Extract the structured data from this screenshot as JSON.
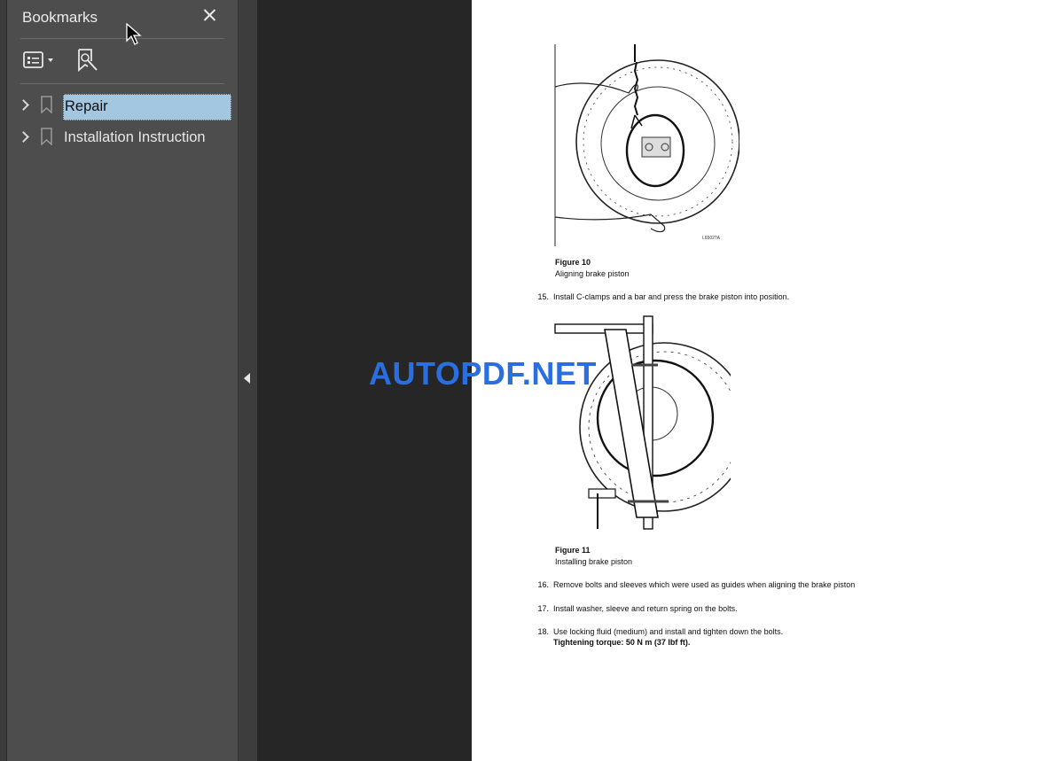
{
  "sidebar": {
    "title": "Bookmarks",
    "bookmarks": [
      {
        "label": "Repair",
        "selected": true
      },
      {
        "label": "Installation Instruction",
        "selected": false
      }
    ]
  },
  "icons": {
    "close": "close-icon",
    "options": "bookmark-options-icon",
    "find": "find-current-bookmark-icon",
    "collapse": "collapse-panel-arrow-icon"
  },
  "document": {
    "figure10": {
      "title": "Figure 10",
      "caption": "Aligning brake piston",
      "code": "L65027A"
    },
    "step15": {
      "num": "15.",
      "text": "Install C-clamps and a bar and press the brake piston into position."
    },
    "figure11": {
      "title": "Figure 11",
      "caption": "Installing brake piston"
    },
    "step16": {
      "num": "16.",
      "text": "Remove bolts and sleeves which were used as guides when aligning the brake piston"
    },
    "step17": {
      "num": "17.",
      "text": "Install washer, sleeve and return spring on the bolts."
    },
    "step18": {
      "num": "18.",
      "text": "Use locking fluid (medium) and install and tighten down the bolts.",
      "bold_line": "Tightening torque: 50 N m (37 lbf ft)."
    }
  },
  "watermark": "AUTOPDF.NET",
  "colors": {
    "selection": "#a3c7e1",
    "watermark": "#2a6fe0",
    "panel": "#4d4d4d"
  }
}
